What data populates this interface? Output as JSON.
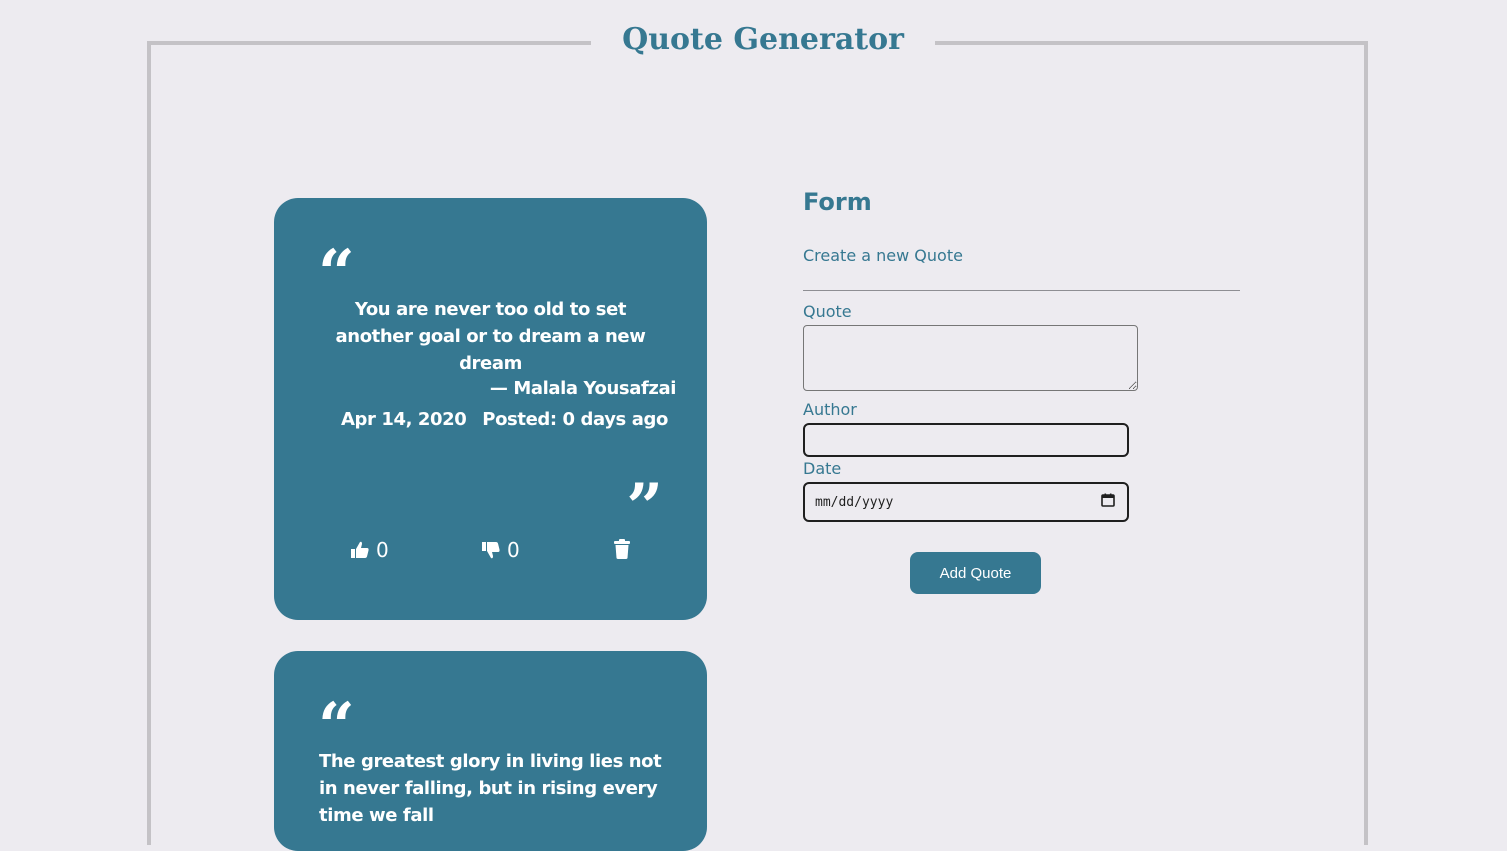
{
  "page": {
    "title": "Quote Generator"
  },
  "quotes": [
    {
      "text": "You are never too old to set another goal or to dream a new dream",
      "author": "— Malala Yousafzai",
      "date": "Apr 14, 2020",
      "posted": "Posted: 0 days ago",
      "likes": "0",
      "dislikes": "0"
    },
    {
      "text": "The greatest glory in living lies not in never falling, but in rising every time we fall"
    }
  ],
  "form": {
    "heading": "Form",
    "subheading": "Create a new Quote",
    "quote_label": "Quote",
    "author_label": "Author",
    "date_label": "Date",
    "date_placeholder": "mm/dd/yyyy",
    "submit_label": "Add Quote"
  },
  "icons": {
    "open_quote": "“",
    "close_quote": "”",
    "like": "thumbs-up-icon",
    "dislike": "thumbs-down-icon",
    "delete": "trash-icon",
    "calendar": "calendar-icon"
  },
  "colors": {
    "accent": "#367891",
    "background": "#edebf0",
    "frame": "#c4c2c6"
  }
}
